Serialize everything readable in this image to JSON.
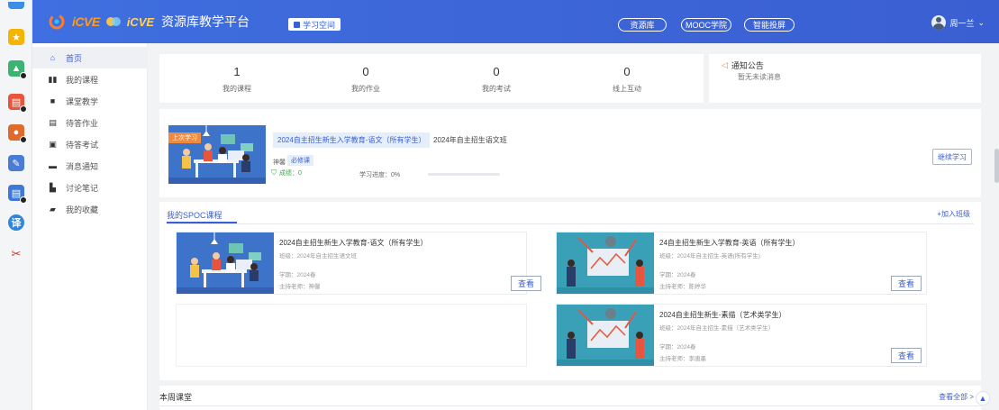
{
  "header": {
    "logo_word1": "iCVE",
    "logo_word2": "iCVE",
    "platform_title": "资源库教学平台",
    "study_space": "学习空间",
    "nav_pills": [
      "资源库",
      "MOOC学院",
      "智能投屏"
    ],
    "user_name": "周一兰",
    "user_caret": "⌄"
  },
  "sidebar": {
    "items": [
      {
        "label": "首页",
        "icon": "home-icon",
        "glyph": "⌂"
      },
      {
        "label": "我的课程",
        "icon": "course-icon",
        "glyph": "▮▮"
      },
      {
        "label": "课堂教学",
        "icon": "classroom-icon",
        "glyph": "■"
      },
      {
        "label": "待答作业",
        "icon": "homework-icon",
        "glyph": "▤"
      },
      {
        "label": "待答考试",
        "icon": "exam-icon",
        "glyph": "▣"
      },
      {
        "label": "消息通知",
        "icon": "message-icon",
        "glyph": "▬"
      },
      {
        "label": "讨论笔记",
        "icon": "note-icon",
        "glyph": "▙"
      },
      {
        "label": "我的收藏",
        "icon": "favorite-icon",
        "glyph": "▰"
      }
    ]
  },
  "stats": [
    {
      "num": "1",
      "label": "我的课程"
    },
    {
      "num": "0",
      "label": "我的作业"
    },
    {
      "num": "0",
      "label": "我的考试"
    },
    {
      "num": "0",
      "label": "线上互动"
    }
  ],
  "notice": {
    "title": "通知公告",
    "empty": "暂无未读消息"
  },
  "last_study": {
    "badge": "上次学习",
    "course": "2024自主招生新生入学教育-语文（所有学生）",
    "class_name": "2024年自主招生语文班",
    "teacher": "神馨",
    "required_tag": "必修课",
    "score": "成绩：0",
    "progress_text": "学习进度：0%",
    "progress_fraction": 0,
    "continue": "继续学习"
  },
  "spoc": {
    "tab": "我的SPOC课程",
    "join": "+加入班级",
    "view_label": "查看",
    "cards": [
      {
        "name": "2024自主招生新生入学教育-语文（所有学生）",
        "class": "班级：2024年自主招生语文班",
        "term": "学期：2024春",
        "teacher": "主持老师：神馨"
      },
      {
        "name": "24自主招生新生入学教育-英语（所有学生）",
        "class": "班级：2024年自主招生-英语(所有学生)",
        "term": "学期：2024春",
        "teacher": "主持老师：陈婷华"
      },
      {
        "name": "2024自主招生新生-素描（艺术类学生）",
        "class": "班级：2024年自主招生-素描（艺术类学生）",
        "term": "学期：2024春",
        "teacher": "主持老师：李唐墨"
      }
    ]
  },
  "week": {
    "title": "本周课堂",
    "more": "查看全部 >"
  },
  "launcher": [
    {
      "icon": "star-app-icon",
      "color": "#f5b400",
      "glyph": "★"
    },
    {
      "icon": "photo-app-icon",
      "color": "#3cb371",
      "glyph": "▲"
    },
    {
      "icon": "pdf-app-icon",
      "color": "#e8553e",
      "glyph": "▤"
    },
    {
      "icon": "office-app-icon",
      "color": "#e06a2c",
      "glyph": "●"
    },
    {
      "icon": "edit-app-icon",
      "color": "#4a7cd6",
      "glyph": "✎"
    },
    {
      "icon": "doc-app-icon",
      "color": "#3e79d8",
      "glyph": "▤"
    },
    {
      "icon": "translate-app-icon",
      "color": "#2f86e0",
      "glyph": "译"
    },
    {
      "icon": "scissors-app-icon",
      "color": "#f4f5f7",
      "glyph": "✂"
    }
  ],
  "colors": {
    "primary": "#3a5fd2",
    "topbar": "#3d66d8",
    "badge_orange": "#f08a3e",
    "illus_bg": "#3d74c9"
  }
}
